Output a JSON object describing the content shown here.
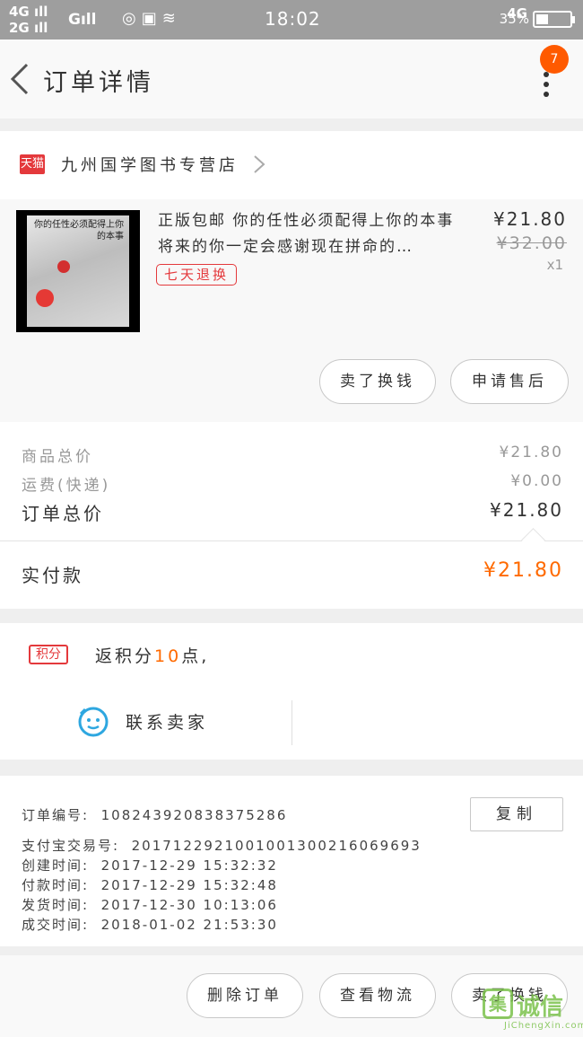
{
  "status_bar": {
    "net_top": "4G",
    "net_bottom": "2G",
    "net_g": "G",
    "time": "18:02",
    "net_right": "4G",
    "battery_pct": "35%",
    "battery_level": 0.35
  },
  "nav": {
    "title": "订单详情",
    "badge": "7"
  },
  "store": {
    "logo": "天猫",
    "name": "九州国学图书专营店"
  },
  "product": {
    "cover_title": "你的任性必须配得上你的本事",
    "title": "正版包邮 你的任性必须配得上你的本事 将来的你一定会感谢现在拼命的…",
    "tag": "七天退换",
    "price": "¥21.80",
    "original_price": "¥32.00",
    "qty": "x1",
    "buy_again": "卖了换钱",
    "after_sale": "申请售后"
  },
  "summary": {
    "goods_label": "商品总价",
    "goods_value": "¥21.80",
    "shipping_label": "运费(快递)",
    "shipping_value": "¥0.00",
    "total_label": "订单总价",
    "total_value": "¥21.80",
    "paid_label": "实付款",
    "paid_value": "¥21.80"
  },
  "points": {
    "tag": "积分",
    "text_prefix": "返积分",
    "num": "10",
    "text_suffix": "点,"
  },
  "contact": {
    "label": "联系卖家"
  },
  "order_info": {
    "order_no_label": "订单编号:",
    "order_no": "1082439208383752​86",
    "copy": "复制",
    "alipay_label": "支付宝交易号:",
    "alipay_no": "2017122921001001300216069693",
    "created_label": "创建时间:",
    "created": "2017-12-29  15:32:32",
    "paid_label": "付款时间:",
    "paid": "2017-12-29  15:32:48",
    "shipped_label": "发货时间:",
    "shipped": "2017-12-30  10:13:06",
    "closed_label": "成交时间:",
    "closed": "2018-01-02  21:53:30"
  },
  "bottom": {
    "delete": "删除订单",
    "logistics": "查看物流",
    "buy_again": "卖了换钱"
  },
  "watermark": {
    "logo": "集",
    "text": "诚信",
    "url": "JiChengXin.com"
  },
  "colors": {
    "accent_orange": "#ff6a00",
    "tmall_red": "#e4393c",
    "status_bar": "#9e9e9e"
  }
}
